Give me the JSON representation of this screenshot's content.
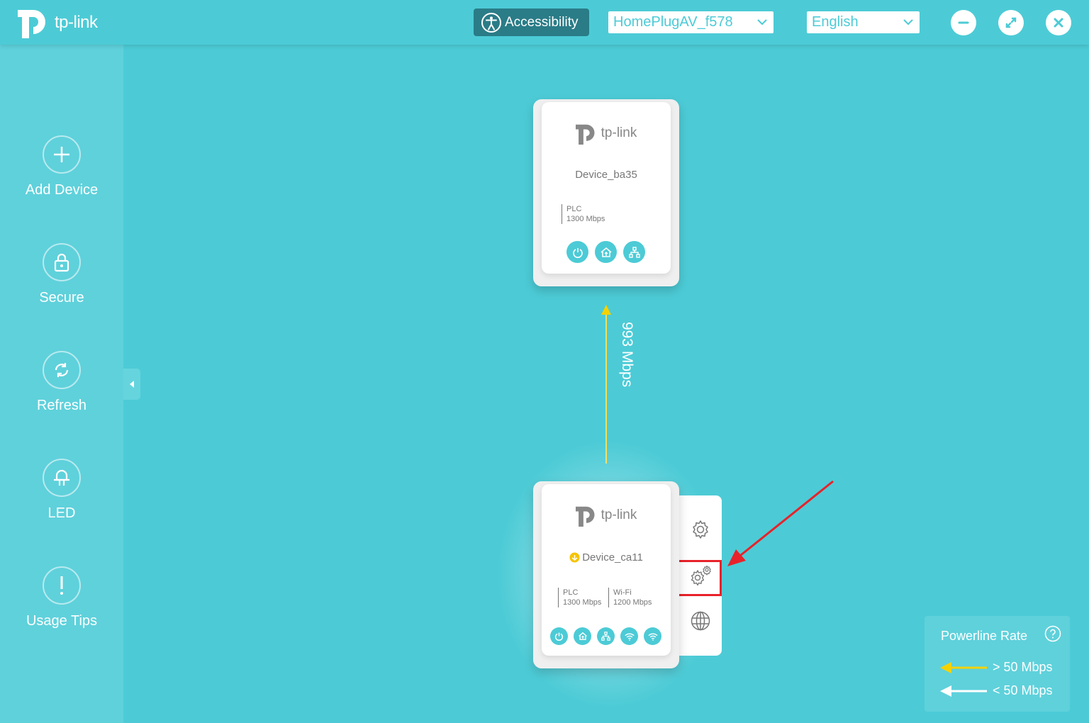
{
  "header": {
    "logo_text": "tp-link",
    "accessibility_label": "Accessibility",
    "network_select": "HomePlugAV_f578",
    "language_select": "English"
  },
  "sidebar": {
    "items": [
      {
        "label": "Add Device",
        "icon": "plus-icon"
      },
      {
        "label": "Secure",
        "icon": "lock-icon"
      },
      {
        "label": "Refresh",
        "icon": "refresh-icon"
      },
      {
        "label": "LED",
        "icon": "led-icon"
      },
      {
        "label": "Usage Tips",
        "icon": "exclamation-icon"
      }
    ]
  },
  "devices": [
    {
      "name": "Device_ba35",
      "logo_text": "tp-link",
      "stats": [
        {
          "label": "PLC",
          "value": "1300 Mbps"
        }
      ],
      "icons": [
        "power-icon",
        "home-icon",
        "network-icon"
      ]
    },
    {
      "name": "Device_ca11",
      "logo_text": "tp-link",
      "stats": [
        {
          "label": "PLC",
          "value": "1300 Mbps"
        },
        {
          "label": "Wi-Fi",
          "value": "1200 Mbps"
        }
      ],
      "icons": [
        "power-icon",
        "home-icon",
        "network-icon",
        "wifi-icon",
        "wifi-icon"
      ],
      "side_panel": [
        "gear-icon",
        "advanced-settings-icon",
        "globe-icon"
      ]
    }
  ],
  "link": {
    "rate": "993 Mbps",
    "color": "#f2dd56"
  },
  "legend": {
    "title": "Powerline Rate",
    "items": [
      {
        "label": "> 50 Mbps",
        "color": "#f5d200"
      },
      {
        "label": "< 50 Mbps",
        "color": "#ffffff"
      }
    ]
  },
  "colors": {
    "accent": "#4ccbd6",
    "highlight": "#e8222a"
  }
}
